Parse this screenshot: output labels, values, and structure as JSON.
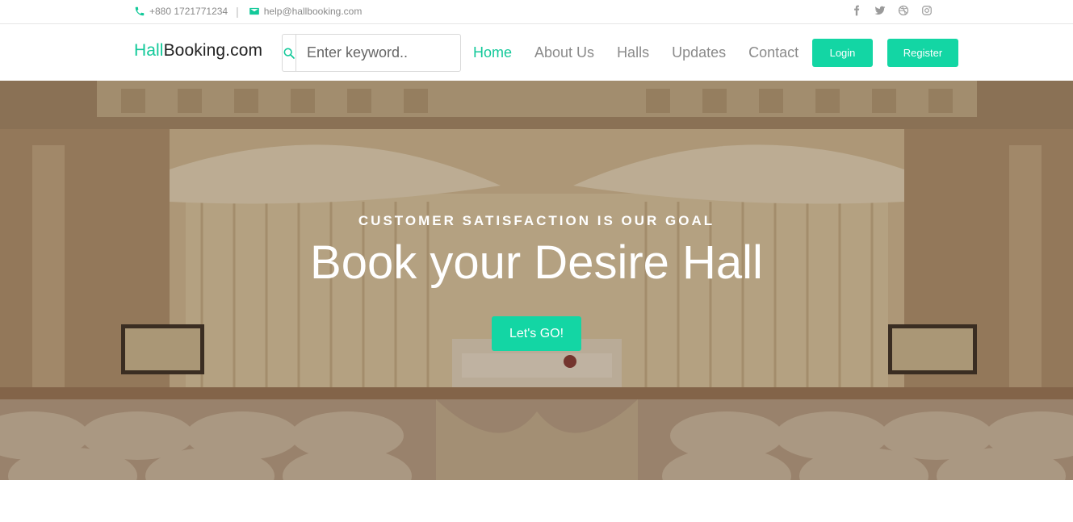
{
  "topbar": {
    "phone": "+880 1721771234",
    "separator": "|",
    "email": "help@hallbooking.com",
    "social_icons": [
      "facebook-icon",
      "twitter-icon",
      "dribbble-icon",
      "instagram-icon"
    ]
  },
  "nav": {
    "logo_accent": "Hall",
    "logo_rest": "Booking.com",
    "search_placeholder": "Enter keyword..",
    "menu": [
      {
        "label": "Home",
        "active": true
      },
      {
        "label": "About Us",
        "active": false
      },
      {
        "label": "Halls",
        "active": false
      },
      {
        "label": "Updates",
        "active": false
      },
      {
        "label": "Contact",
        "active": false
      }
    ],
    "login_label": "Login",
    "register_label": "Register"
  },
  "hero": {
    "tagline": "CUSTOMER SATISFACTION IS OUR GOAL",
    "headline": "Book your Desire Hall",
    "cta_label": "Let's GO!"
  },
  "colors": {
    "accent": "#13c99a",
    "button": "#13d6a4",
    "muted_text": "#8a8a8a"
  }
}
